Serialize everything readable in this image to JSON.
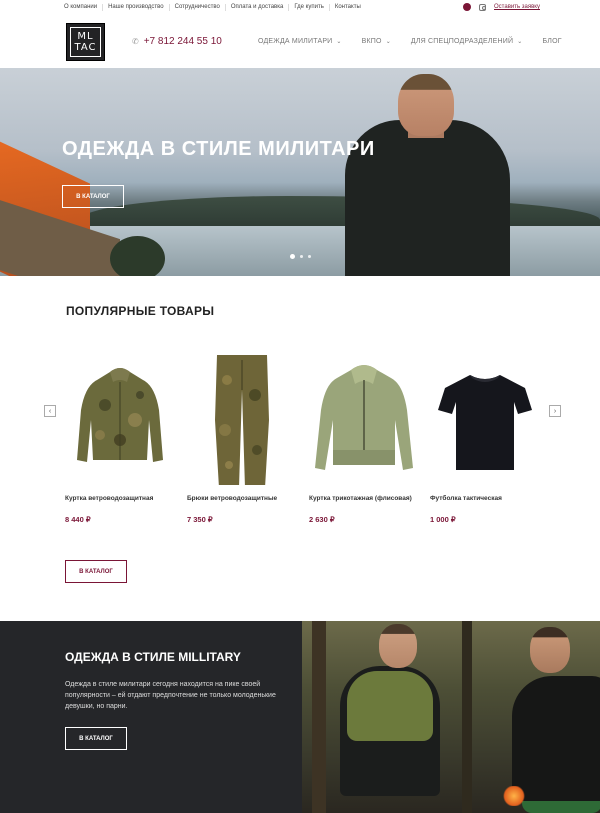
{
  "topbar": {
    "links": [
      "О компании",
      "Наше производство",
      "Сотрудничество",
      "Оплата и доставка",
      "Где купить",
      "Контакты"
    ],
    "callback_label": "Оставить заявку",
    "icons": [
      "viber-icon",
      "instagram-icon"
    ]
  },
  "header": {
    "logo_line1": "ML",
    "logo_line2": "TAC",
    "phone": "+7 812 244 55 10",
    "nav": [
      {
        "label": "Одежда милитари",
        "dropdown": true
      },
      {
        "label": "ВКПО",
        "dropdown": true
      },
      {
        "label": "Для спецподразделений",
        "dropdown": true
      },
      {
        "label": "Блог",
        "dropdown": false
      }
    ]
  },
  "hero": {
    "title": "ОДЕЖДА В СТИЛЕ МИЛИТАРИ",
    "button": "В каталог",
    "slides_count": 3,
    "active_slide": 1
  },
  "popular": {
    "title": "ПОПУЛЯРНЫЕ ТОВАРЫ",
    "products": [
      {
        "name": "Куртка ветроводозащитная",
        "price": "8 440 ₽"
      },
      {
        "name": "Брюки ветроводозащитные",
        "price": "7 350 ₽"
      },
      {
        "name": "Куртка трикотажная (флисовая)",
        "price": "2 630 ₽"
      },
      {
        "name": "Футболка тактическая",
        "price": "1 000 ₽"
      }
    ],
    "button": "В каталог"
  },
  "promo": {
    "title": "ОДЕЖДА В СТИЛЕ MILLITARY",
    "text": "Одежда в стиле милитари сегодня находится на пике своей популярности – ей отдают предпочтение не только молоденькие девушки, но парни.",
    "button": "В каталог"
  },
  "colors": {
    "accent": "#7a1536",
    "dark_panel": "#252629"
  }
}
